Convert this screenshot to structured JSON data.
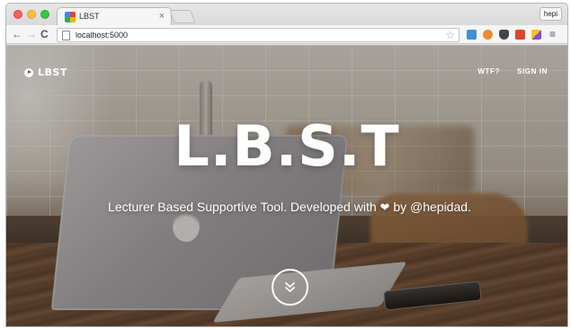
{
  "browser": {
    "tab_title": "LBST",
    "tab_close": "×",
    "profile_name": "hepi",
    "url": "localhost:5000",
    "nav_back": "←",
    "nav_forward": "→",
    "nav_reload": "C",
    "bookmark_icon": "☆",
    "menu_icon": "≡",
    "extensions": [
      "extension-blue-icon",
      "extension-orange-icon",
      "pocket-icon",
      "extension-red-icon",
      "extension-multicolor-icon"
    ]
  },
  "site": {
    "brand": "LBST",
    "nav": {
      "wtf": "WTF?",
      "sign_in": "SIGN IN"
    },
    "hero": {
      "title": "L.B.S.T",
      "subtitle_part1": "Lecturer Based Supportive Tool. Developed with",
      "heart": "❤",
      "subtitle_part2": "by @hepidad."
    },
    "scroll_icon": "double-chevron-down-icon"
  },
  "colors": {
    "hero_text": "#ffffff",
    "red_light": "#fc605b",
    "yellow_light": "#fdbc40",
    "green_light": "#34c84a"
  }
}
